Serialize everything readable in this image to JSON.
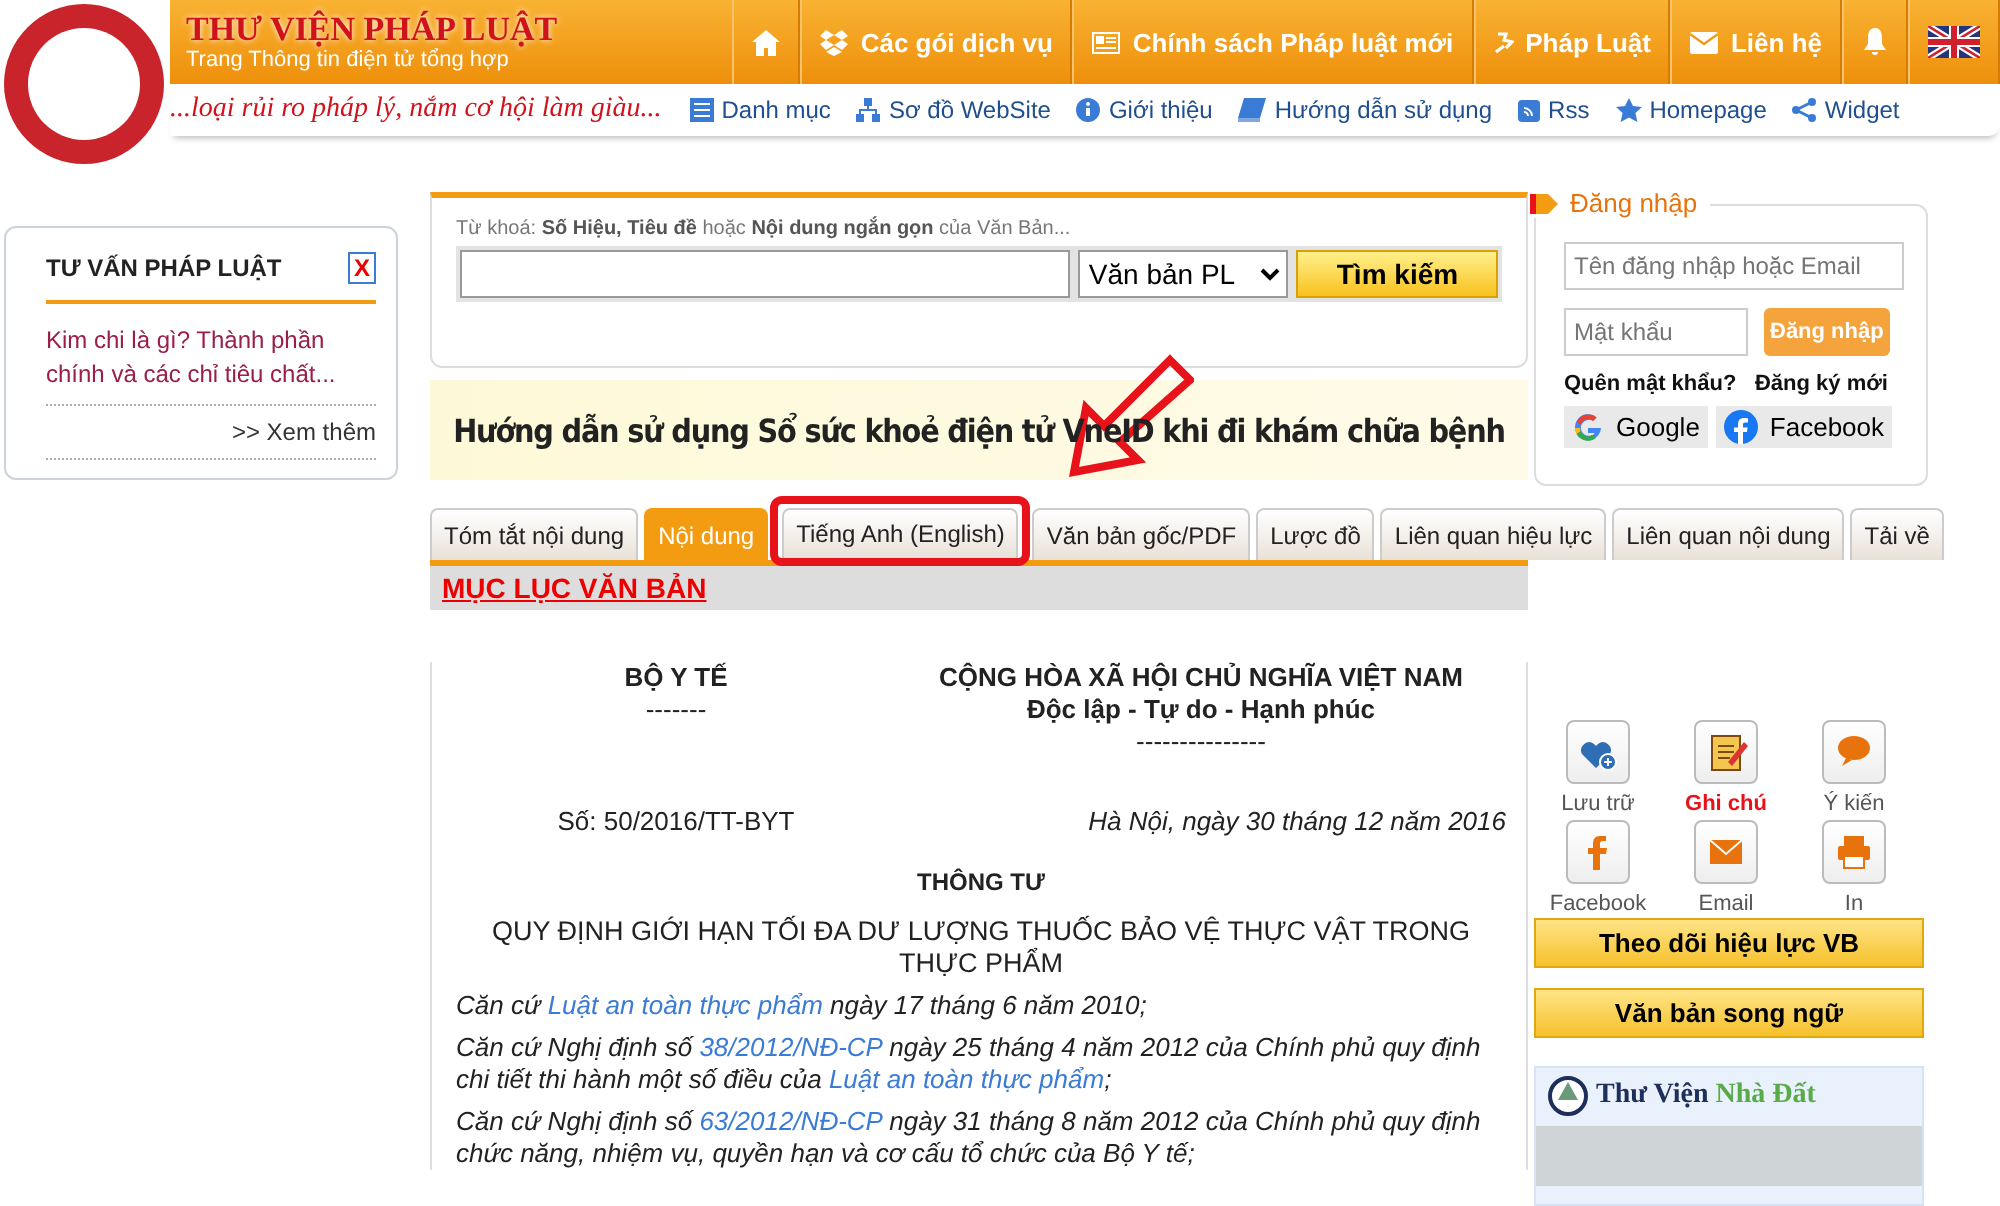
{
  "header": {
    "title": "THƯ VIỆN PHÁP LUẬT",
    "subtitle": "Trang Thông tin điện tử tổng hợp",
    "slogan": "...loại rủi ro pháp lý, nắm cơ hội làm giàu...",
    "nav": [
      {
        "kind": "home"
      },
      {
        "kind": "package",
        "label": "Các gói dịch vụ"
      },
      {
        "kind": "news",
        "label": "Chính sách Pháp luật mới"
      },
      {
        "kind": "law",
        "label": "Pháp Luật"
      },
      {
        "kind": "mail",
        "label": "Liên hệ"
      },
      {
        "kind": "bell"
      },
      {
        "kind": "flag"
      }
    ],
    "links": [
      {
        "kind": "list",
        "label": "Danh mục"
      },
      {
        "kind": "sitemap",
        "label": "Sơ đồ WebSite"
      },
      {
        "kind": "info",
        "label": "Giới thiệu"
      },
      {
        "kind": "book",
        "label": "Hướng dẫn sử dụng"
      },
      {
        "kind": "rss",
        "label": "Rss"
      },
      {
        "kind": "star",
        "label": "Homepage"
      },
      {
        "kind": "share",
        "label": "Widget"
      }
    ]
  },
  "advice": {
    "title": "TƯ VẤN PHÁP LUẬT",
    "close": "X",
    "item": "Kim chi là gì? Thành phần chính và các chỉ tiêu chất...",
    "more": ">> Xem thêm"
  },
  "search": {
    "hint": "Từ khoá: **Số Hiệu, Tiêu đề** hoặc **Nội dung ngắn gọn** của Văn Bản...",
    "select": "Văn bản PL",
    "button": "Tìm kiếm"
  },
  "banner": "Hướng dẫn sử dụng Sổ sức khoẻ điện tử VneID khi đi khám chữa bệnh",
  "tabs": [
    {
      "label": "Tóm tắt nội dung",
      "selected": false,
      "annotated": false
    },
    {
      "label": "Nội dung",
      "selected": true,
      "annotated": false
    },
    {
      "label": "Tiếng Anh (English)",
      "selected": false,
      "annotated": true
    },
    {
      "label": "Văn bản gốc/PDF",
      "selected": false,
      "annotated": false
    },
    {
      "label": "Lược đồ",
      "selected": false,
      "annotated": false
    },
    {
      "label": "Liên quan hiệu lực",
      "selected": false,
      "annotated": false
    },
    {
      "label": "Liên quan nội dung",
      "selected": false,
      "annotated": false
    },
    {
      "label": "Tải về",
      "selected": false,
      "annotated": false
    }
  ],
  "toc": "MỤC LỤC VĂN BẢN",
  "document": {
    "agency": "BỘ Y TẾ",
    "agency_rule": "-------",
    "nation": "CỘNG HÒA XÃ HỘI CHỦ NGHĨA VIỆT NAM",
    "motto": "Độc lập - Tự do - Hạnh phúc",
    "motto_rule": "---------------",
    "number": "Số: 50/2016/TT-BYT",
    "date": "Hà Nội, ngày 30 tháng 12 năm 2016",
    "type": "THÔNG TƯ",
    "title": "QUY ĐỊNH GIỚI HẠN TỐI ĐA DƯ LƯỢNG THUỐC BẢO VỆ THỰC VẬT TRONG THỰC PHẨM",
    "paragraphs": [
      [
        {
          "text": "Căn cứ ",
          "link": false
        },
        {
          "text": "Luật an toàn thực phẩm",
          "link": true
        },
        {
          "text": " ngày 17 tháng 6 năm 2010;",
          "link": false
        }
      ],
      [
        {
          "text": "Căn cứ Nghị định số ",
          "link": false
        },
        {
          "text": "38/2012/NĐ-CP",
          "link": true
        },
        {
          "text": " ngày 25 tháng 4 năm 2012 của Chính phủ quy định chi tiết thi hành một số điều của ",
          "link": false
        },
        {
          "text": "Luật an toàn thực phẩm",
          "link": true
        },
        {
          "text": ";",
          "link": false
        }
      ],
      [
        {
          "text": "Căn cứ Nghị định số ",
          "link": false
        },
        {
          "text": "63/2012/NĐ-CP",
          "link": true
        },
        {
          "text": " ngày 31 tháng 8 năm 2012 của Chính phủ quy định chức năng, nhiệm vụ, quyền hạn và cơ cấu tổ chức của Bộ Y tế;",
          "link": false
        }
      ]
    ]
  },
  "login": {
    "title": "Đăng nhập",
    "username_placeholder": "Tên đăng nhập hoặc Email",
    "password_placeholder": "Mật khẩu",
    "button": "Đăng nhập",
    "forgot": "Quên mật khẩu?",
    "register": "Đăng ký mới",
    "google": "Google",
    "facebook": "Facebook"
  },
  "actions": [
    {
      "kind": "save",
      "label": "Lưu trữ",
      "highlighted": false
    },
    {
      "kind": "note",
      "label": "Ghi chú",
      "highlighted": true
    },
    {
      "kind": "comment",
      "label": "Ý kiến",
      "highlighted": false
    },
    {
      "kind": "facebook",
      "label": "Facebook",
      "highlighted": false
    },
    {
      "kind": "email",
      "label": "Email",
      "highlighted": false
    },
    {
      "kind": "print",
      "label": "In",
      "highlighted": false
    }
  ],
  "side_buttons": [
    "Theo dõi hiệu lực VB",
    "Văn bản song ngữ"
  ],
  "land": {
    "title_parts": [
      {
        "text": "Thư Viện",
        "accent": false
      },
      {
        "text": "Nhà Đất",
        "accent": true
      }
    ]
  }
}
